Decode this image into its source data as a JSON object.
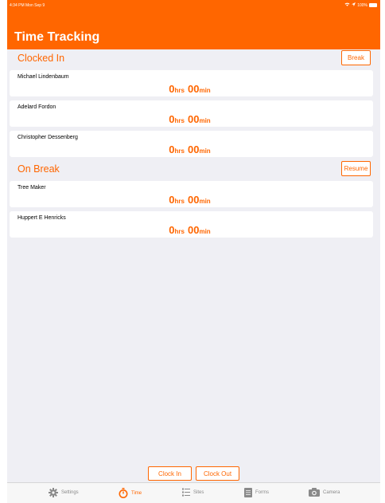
{
  "status_bar": {
    "time": "4:34 PM  Mon Sep 9",
    "battery": "100%"
  },
  "header": {
    "title": "Time Tracking"
  },
  "clocked_in": {
    "title": "Clocked In",
    "button": "Break",
    "items": [
      {
        "name": "Michael Lindenbaum",
        "hrs": "0",
        "hrs_unit": "hrs",
        "min": "00",
        "min_unit": "min"
      },
      {
        "name": "Adelard Fordon",
        "hrs": "0",
        "hrs_unit": "hrs",
        "min": "00",
        "min_unit": "min"
      },
      {
        "name": "Christopher Dessenberg",
        "hrs": "0",
        "hrs_unit": "hrs",
        "min": "00",
        "min_unit": "min"
      }
    ]
  },
  "on_break": {
    "title": "On Break",
    "button": "Resume",
    "items": [
      {
        "name": "Tree Maker",
        "hrs": "0",
        "hrs_unit": "hrs",
        "min": "00",
        "min_unit": "min"
      },
      {
        "name": "Huppert E Henricks",
        "hrs": "0",
        "hrs_unit": "hrs",
        "min": "00",
        "min_unit": "min"
      }
    ]
  },
  "actions": {
    "clock_in": "Clock In",
    "clock_out": "Clock Out"
  },
  "tabs": [
    {
      "label": "Settings",
      "icon": "gear-icon"
    },
    {
      "label": "Time",
      "icon": "stopwatch-icon"
    },
    {
      "label": "Sites",
      "icon": "list-icon"
    },
    {
      "label": "Forms",
      "icon": "document-icon"
    },
    {
      "label": "Camera",
      "icon": "camera-icon"
    }
  ],
  "colors": {
    "accent": "#ff6600",
    "background": "#efeff4",
    "inactive_tab": "#8a8a8a"
  }
}
